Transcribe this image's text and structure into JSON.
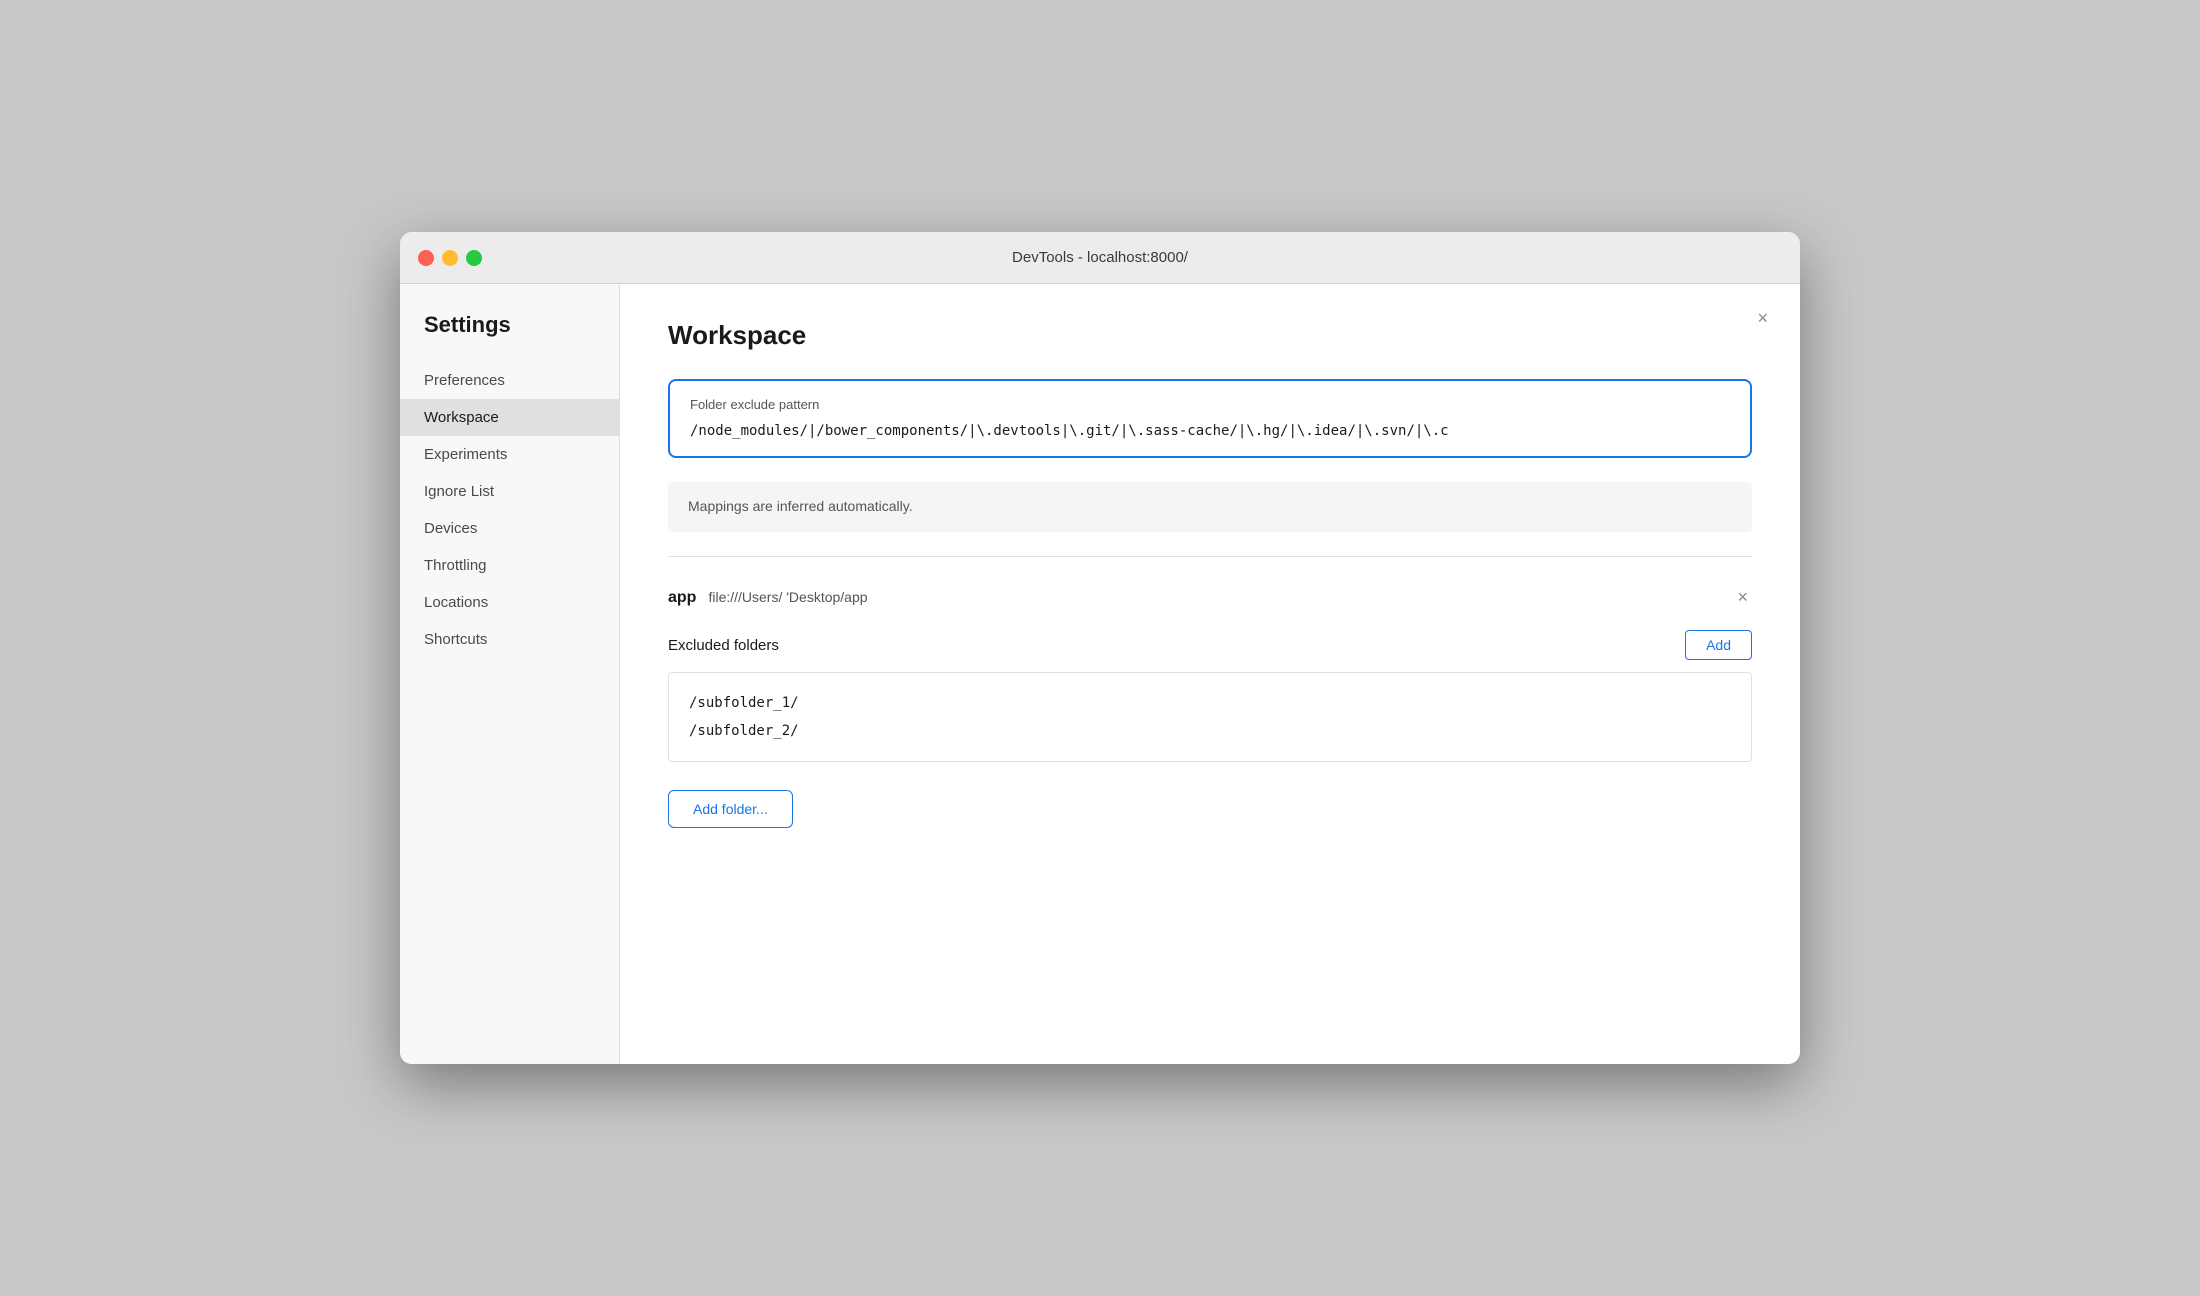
{
  "titlebar": {
    "title": "DevTools - localhost:8000/"
  },
  "sidebar": {
    "heading": "Settings",
    "items": [
      {
        "id": "preferences",
        "label": "Preferences",
        "active": false
      },
      {
        "id": "workspace",
        "label": "Workspace",
        "active": true
      },
      {
        "id": "experiments",
        "label": "Experiments",
        "active": false
      },
      {
        "id": "ignore-list",
        "label": "Ignore List",
        "active": false
      },
      {
        "id": "devices",
        "label": "Devices",
        "active": false
      },
      {
        "id": "throttling",
        "label": "Throttling",
        "active": false
      },
      {
        "id": "locations",
        "label": "Locations",
        "active": false
      },
      {
        "id": "shortcuts",
        "label": "Shortcuts",
        "active": false
      }
    ]
  },
  "main": {
    "title": "Workspace",
    "folder_exclude": {
      "label": "Folder exclude pattern",
      "value": "/node_modules/|/bower_components/|\\.devtools|\\.git/|\\.sass-cache/|\\.hg/|\\.idea/|\\.svn/|\\.c"
    },
    "mappings_info": "Mappings are inferred automatically.",
    "workspace_entry": {
      "name": "app",
      "path": "file:///Users/      'Desktop/app"
    },
    "excluded_folders_label": "Excluded folders",
    "add_label": "Add",
    "subfolders": [
      "/subfolder_1/",
      "/subfolder_2/"
    ],
    "add_folder_label": "Add folder..."
  }
}
